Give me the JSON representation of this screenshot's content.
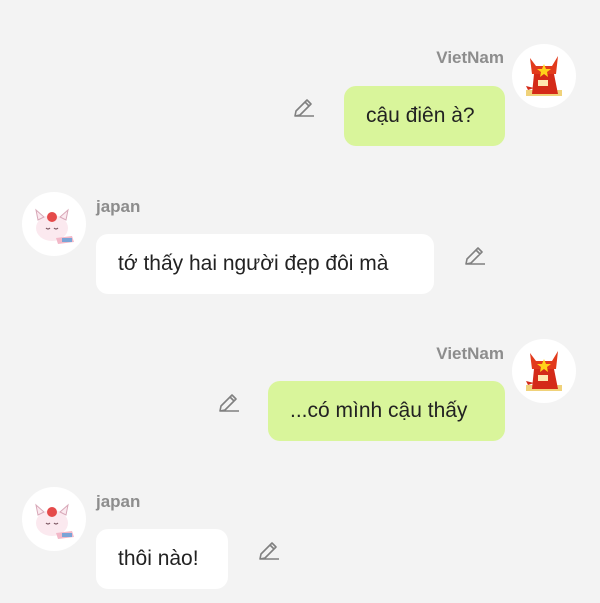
{
  "messages": [
    {
      "sender": "VietNam",
      "text": "cậu điên à?",
      "side": "right",
      "avatar_icon": "vietnam-cat-icon"
    },
    {
      "sender": "japan",
      "text": "tớ thấy hai người đẹp đôi mà",
      "side": "left",
      "avatar_icon": "japan-cat-icon"
    },
    {
      "sender": "VietNam",
      "text": "...có mình cậu thấy",
      "side": "right",
      "avatar_icon": "vietnam-cat-icon"
    },
    {
      "sender": "japan",
      "text": "thôi nào!",
      "side": "left",
      "avatar_icon": "japan-cat-icon"
    }
  ],
  "colors": {
    "background": "#f3f3f3",
    "outgoing_bubble": "#d9f59b",
    "incoming_bubble": "#ffffff",
    "sender_name": "#8d8d8d"
  },
  "icons": {
    "edit": "pencil-edit-icon"
  }
}
